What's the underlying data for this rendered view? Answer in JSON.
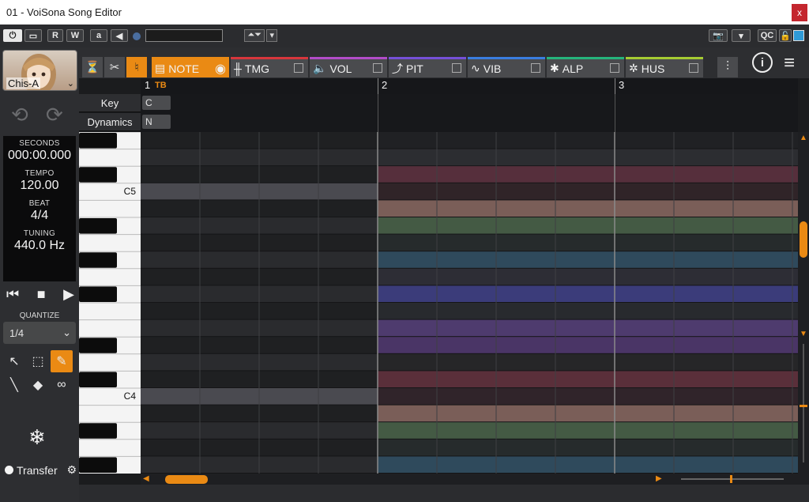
{
  "window": {
    "title": "01 - VoiSona Song Editor",
    "close_label": "x"
  },
  "toolbar": {
    "r_label": "R",
    "w_label": "W",
    "a_label": "a",
    "qc_label": "QC",
    "dropdown_glyph": "▾",
    "updown_glyph": "⏶⏷"
  },
  "singer": {
    "name": "Chis-A"
  },
  "info": {
    "seconds_label": "SECONDS",
    "seconds_value": "000:00.000",
    "tempo_label": "TEMPO",
    "tempo_value": "120.00",
    "beat_label": "BEAT",
    "beat_value": "4/4",
    "tuning_label": "TUNING",
    "tuning_value": "440.0 Hz"
  },
  "quantize": {
    "label": "QUANTIZE",
    "value": "1/4"
  },
  "transfer": {
    "label": "Transfer"
  },
  "tabs": [
    {
      "label": "NOTE",
      "color": "#ea8a14"
    },
    {
      "label": "TMG",
      "color": "#d8363c"
    },
    {
      "label": "VOL",
      "color": "#b24cc8"
    },
    {
      "label": "PIT",
      "color": "#7650d8"
    },
    {
      "label": "VIB",
      "color": "#3a7ee0"
    },
    {
      "label": "ALP",
      "color": "#25b47c"
    },
    {
      "label": "HUS",
      "color": "#a6cc32"
    }
  ],
  "ruler": {
    "tb_label": "TB",
    "bars": [
      "1",
      "2",
      "3"
    ]
  },
  "meta": {
    "key_label": "Key",
    "key_value": "C",
    "dynamics_label": "Dynamics",
    "dynamics_value": "N"
  },
  "piano": {
    "labels": [
      "C5",
      "C4"
    ]
  },
  "scroll": {
    "vertical_position": 0.3,
    "horizontal_position": 0.05
  },
  "row_colors": [
    "#202124",
    "#2c2d31",
    "#562f3c",
    "#302428",
    "#7a5e58",
    "#445a44",
    "#262b2c",
    "#2f4a5c",
    "#2d2d35",
    "#3b3c7a",
    "#282a2e",
    "#4e3b6e",
    "#4a3566",
    "#262628",
    "#5a2f3a",
    "#30242a",
    "#7a5e58",
    "#445a44",
    "#262b2c",
    "#2f4a5c"
  ]
}
